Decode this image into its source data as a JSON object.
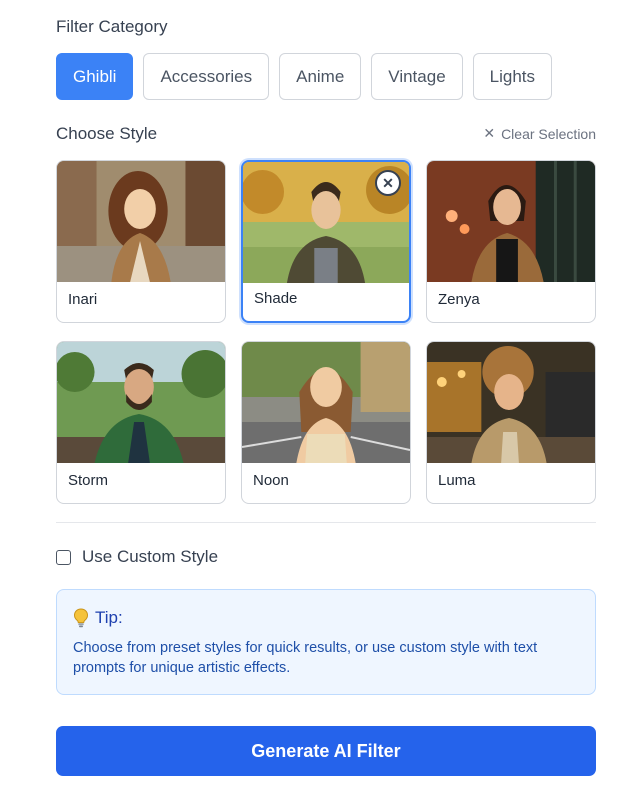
{
  "filter_category": {
    "title": "Filter Category",
    "chips": [
      {
        "label": "Ghibli",
        "active": true
      },
      {
        "label": "Accessories",
        "active": false
      },
      {
        "label": "Anime",
        "active": false
      },
      {
        "label": "Vintage",
        "active": false
      },
      {
        "label": "Lights",
        "active": false
      }
    ]
  },
  "choose_style": {
    "title": "Choose Style",
    "clear_label": "Clear Selection",
    "styles": [
      {
        "name": "Inari",
        "selected": false
      },
      {
        "name": "Shade",
        "selected": true
      },
      {
        "name": "Zenya",
        "selected": false
      },
      {
        "name": "Storm",
        "selected": false
      },
      {
        "name": "Noon",
        "selected": false
      },
      {
        "name": "Luma",
        "selected": false
      }
    ]
  },
  "custom_style": {
    "label": "Use Custom Style",
    "checked": false
  },
  "tip": {
    "icon": "lightbulb-icon",
    "title": "Tip:",
    "text": "Choose from preset styles for quick results, or use custom style with text prompts for unique artistic effects."
  },
  "generate_button": {
    "label": "Generate AI Filter"
  },
  "colors": {
    "accent": "#3b82f6",
    "button": "#2563eb",
    "tip_bg": "#eff6ff",
    "tip_text": "#1e40af"
  }
}
